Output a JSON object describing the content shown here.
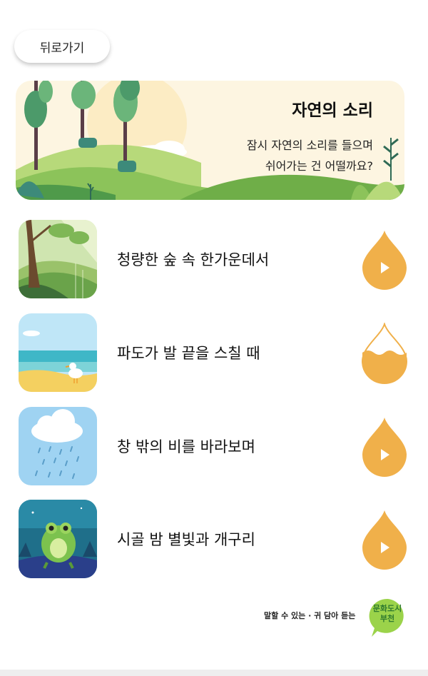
{
  "nav": {
    "back_label": "뒤로가기"
  },
  "banner": {
    "title": "자연의 소리",
    "description": "잠시 자연의 소리를 들으며\n쉬어가는 건 어떨까요?"
  },
  "tracks": [
    {
      "title": "청량한 숲 속 한가운데서",
      "state": "paused"
    },
    {
      "title": "파도가 발 끝을 스칠 때",
      "state": "playing"
    },
    {
      "title": "창 밖의 비를 바라보며",
      "state": "paused"
    },
    {
      "title": "시골 밤 별빛과 개구리",
      "state": "paused"
    }
  ],
  "footer": {
    "slogan": "말할 수 있는 · 귀 담아 듣는",
    "badge_text": "문화도시\n부천"
  },
  "colors": {
    "accent": "#f0b04a",
    "banner_bg": "#fdf3d8",
    "hill_green": "#8cc35a",
    "badge_green": "#9bd34a"
  },
  "icons": {
    "play": "play-icon",
    "water_drop": "water-drop-icon"
  }
}
